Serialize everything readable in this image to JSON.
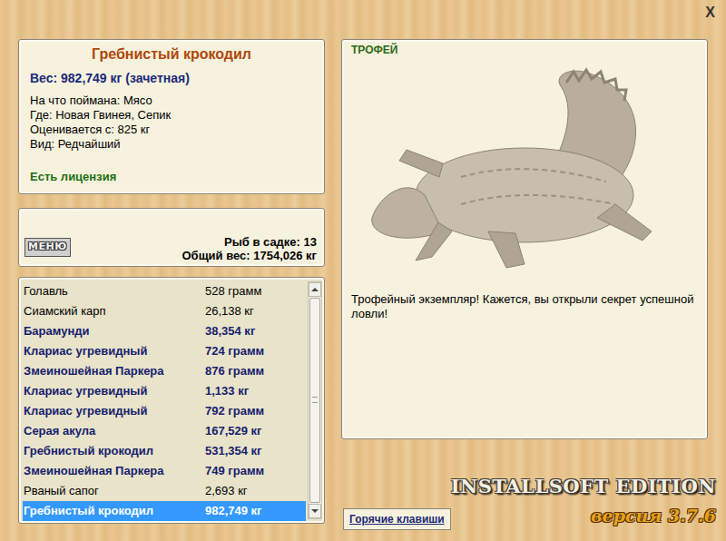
{
  "window": {
    "close": "X"
  },
  "info": {
    "title": "Гребнистый крокодил",
    "weight": "Вес: 982,749 кг (зачетная)",
    "lines": [
      "На что поймана: Мясо",
      "Где: Новая Гвинея, Сепик",
      "Оценивается с: 825 кг",
      "Вид: Редчайший"
    ],
    "license": "Есть лицензия"
  },
  "keepnet": {
    "menu_button": "МЕНЮ",
    "count": "Рыб в садке: 13",
    "total": "Общий вес: 1754,026 кг"
  },
  "catch_list": {
    "items": [
      {
        "name": "Голавль",
        "weight": "528 грамм",
        "bold": false,
        "selected": false
      },
      {
        "name": "Сиамский карп",
        "weight": "26,138 кг",
        "bold": false,
        "selected": false
      },
      {
        "name": "Барамунди",
        "weight": "38,354 кг",
        "bold": true,
        "selected": false
      },
      {
        "name": "Клариас угревидный",
        "weight": "724 грамм",
        "bold": true,
        "selected": false
      },
      {
        "name": "Змеиношейная Паркера",
        "weight": "876 грамм",
        "bold": true,
        "selected": false
      },
      {
        "name": "Клариас угревидный",
        "weight": "1,133 кг",
        "bold": true,
        "selected": false
      },
      {
        "name": "Клариас угревидный",
        "weight": "792 грамм",
        "bold": true,
        "selected": false
      },
      {
        "name": "Серая акула",
        "weight": "167,529 кг",
        "bold": true,
        "selected": false
      },
      {
        "name": "Гребнистый крокодил",
        "weight": "531,354 кг",
        "bold": true,
        "selected": false
      },
      {
        "name": "Змеиношейная Паркера",
        "weight": "749 грамм",
        "bold": true,
        "selected": false
      },
      {
        "name": "Рваный сапог",
        "weight": "2,693 кг",
        "bold": false,
        "selected": false
      },
      {
        "name": "Гребнистый крокодил",
        "weight": "982,749 кг",
        "bold": true,
        "selected": true
      }
    ],
    "scrollbar": {
      "level": 1
    }
  },
  "trophy": {
    "label": "ТРОФЕЙ",
    "text": "Трофейный экземпляр! Кажется, вы открыли секрет успешной ловли!"
  },
  "footer": {
    "hotkeys": "Горячие клавиши",
    "logo": "INSTALLSOFT EDITION",
    "version": "версия 3.7.6"
  }
}
